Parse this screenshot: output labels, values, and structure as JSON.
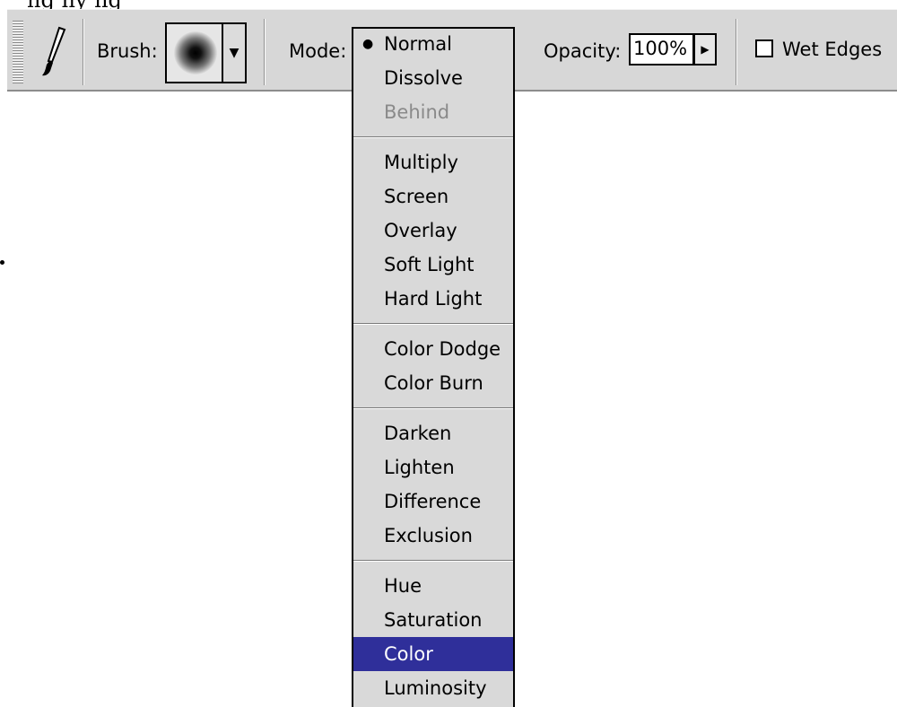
{
  "scan_fragment": "ng ny ng",
  "toolbar": {
    "tool_icon": "paintbrush-icon",
    "brush_label": "Brush:",
    "mode_label": "Mode:",
    "mode_value": "Normal",
    "opacity_label": "Opacity:",
    "opacity_value": "100%",
    "wet_edges_label": "Wet Edges",
    "wet_edges_checked": false
  },
  "mode_menu": {
    "groups": [
      [
        {
          "label": "Normal",
          "checked": true,
          "disabled": false,
          "highlighted": false
        },
        {
          "label": "Dissolve",
          "checked": false,
          "disabled": false,
          "highlighted": false
        },
        {
          "label": "Behind",
          "checked": false,
          "disabled": true,
          "highlighted": false
        }
      ],
      [
        {
          "label": "Multiply",
          "checked": false,
          "disabled": false,
          "highlighted": false
        },
        {
          "label": "Screen",
          "checked": false,
          "disabled": false,
          "highlighted": false
        },
        {
          "label": "Overlay",
          "checked": false,
          "disabled": false,
          "highlighted": false
        },
        {
          "label": "Soft Light",
          "checked": false,
          "disabled": false,
          "highlighted": false
        },
        {
          "label": "Hard Light",
          "checked": false,
          "disabled": false,
          "highlighted": false
        }
      ],
      [
        {
          "label": "Color Dodge",
          "checked": false,
          "disabled": false,
          "highlighted": false
        },
        {
          "label": "Color Burn",
          "checked": false,
          "disabled": false,
          "highlighted": false
        }
      ],
      [
        {
          "label": "Darken",
          "checked": false,
          "disabled": false,
          "highlighted": false
        },
        {
          "label": "Lighten",
          "checked": false,
          "disabled": false,
          "highlighted": false
        },
        {
          "label": "Difference",
          "checked": false,
          "disabled": false,
          "highlighted": false
        },
        {
          "label": "Exclusion",
          "checked": false,
          "disabled": false,
          "highlighted": false
        }
      ],
      [
        {
          "label": "Hue",
          "checked": false,
          "disabled": false,
          "highlighted": false
        },
        {
          "label": "Saturation",
          "checked": false,
          "disabled": false,
          "highlighted": false
        },
        {
          "label": "Color",
          "checked": false,
          "disabled": false,
          "highlighted": true
        },
        {
          "label": "Luminosity",
          "checked": false,
          "disabled": false,
          "highlighted": false
        }
      ]
    ]
  },
  "colors": {
    "toolbar_bg": "#d7d7d7",
    "menu_bg": "#d9d9d9",
    "highlight_bg": "#2f2f9a",
    "disabled_text": "#8a8a8a"
  }
}
